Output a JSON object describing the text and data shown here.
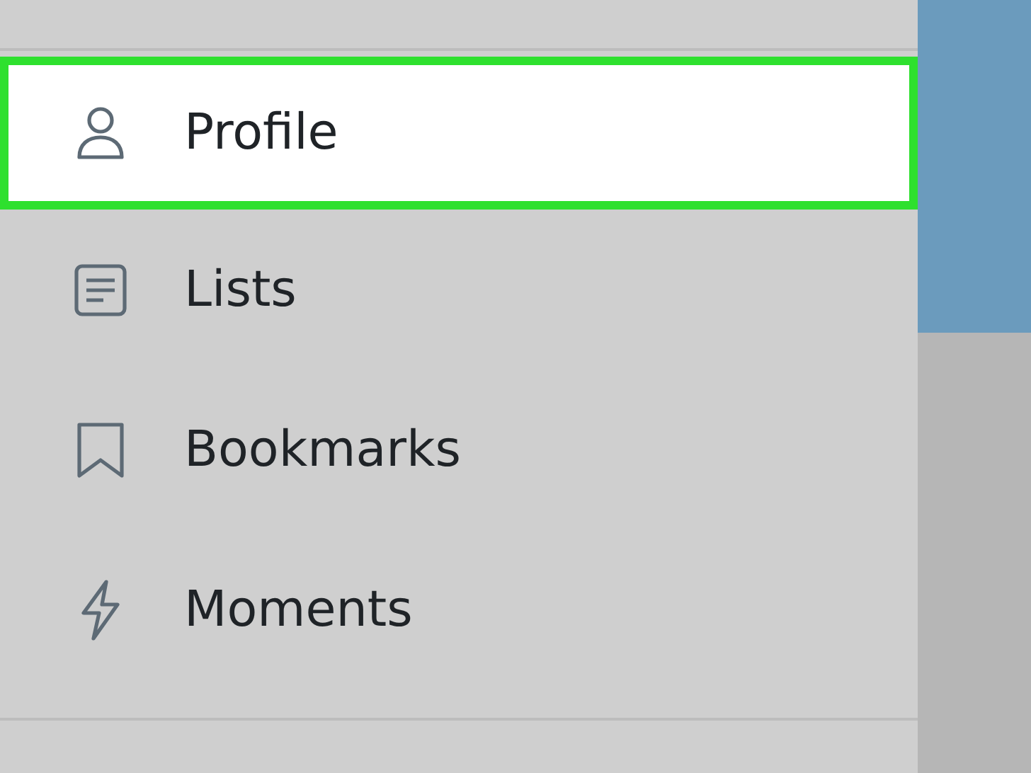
{
  "menu": {
    "items": [
      {
        "kind": "person",
        "label": "Profile",
        "selected": true
      },
      {
        "kind": "list",
        "label": "Lists",
        "selected": false
      },
      {
        "kind": "bookmark",
        "label": "Bookmarks",
        "selected": false
      },
      {
        "kind": "bolt",
        "label": "Moments",
        "selected": false
      }
    ]
  }
}
